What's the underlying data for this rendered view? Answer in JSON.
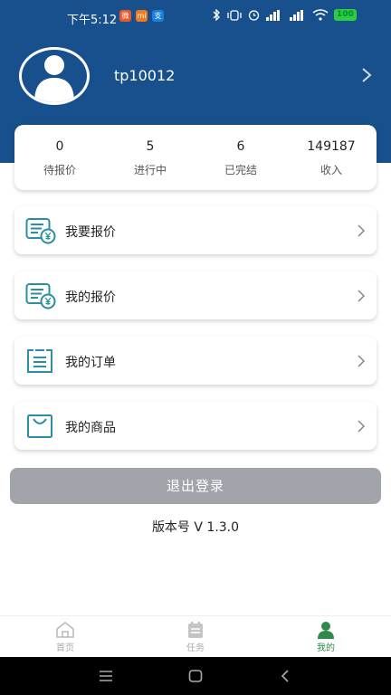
{
  "status_bar": {
    "time": "下午5:12",
    "apps": [
      "微",
      "mi",
      "支"
    ],
    "battery": "100"
  },
  "profile": {
    "username": "tp10012"
  },
  "stats": [
    {
      "value": "0",
      "label": "待报价"
    },
    {
      "value": "5",
      "label": "进行中"
    },
    {
      "value": "6",
      "label": "已完结"
    },
    {
      "value": "149187",
      "label": "收入"
    }
  ],
  "menu": [
    {
      "label": "我要报价",
      "icon": "quote-icon"
    },
    {
      "label": "我的报价",
      "icon": "my-quote-icon"
    },
    {
      "label": "我的订单",
      "icon": "order-icon"
    },
    {
      "label": "我的商品",
      "icon": "product-bag-icon"
    }
  ],
  "logout_label": "退出登录",
  "version": "版本号  V 1.3.0",
  "tabs": [
    {
      "label": "首页",
      "icon": "home-icon"
    },
    {
      "label": "任务",
      "icon": "task-icon"
    },
    {
      "label": "我的",
      "icon": "profile-icon"
    }
  ],
  "colors": {
    "header": "#17508c",
    "icon_teal": "#2a8fa0",
    "logout": "#a2a4ab",
    "tab_active": "#2f8a4b"
  }
}
